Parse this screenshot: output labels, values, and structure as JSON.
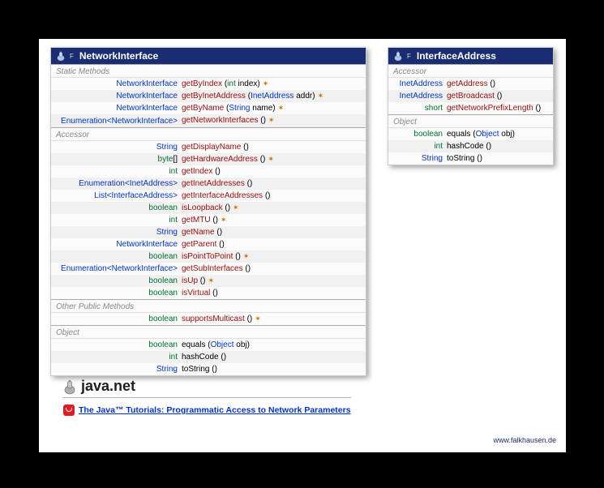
{
  "panel1": {
    "title": "NetworkInterface",
    "flag": "F",
    "sections": [
      {
        "label": "Static Methods",
        "rows": [
          {
            "ret_html": "<span class='type'>NetworkInterface</span>",
            "name": "getByIndex",
            "params_html": "(<span class='pprim'>int</span> index)",
            "throws": true,
            "red": true
          },
          {
            "ret_html": "<span class='type'>NetworkInterface</span>",
            "name": "getByInetAddress",
            "params_html": "(<span class='paramtype'>InetAddress</span> addr)",
            "throws": true,
            "red": true
          },
          {
            "ret_html": "<span class='type'>NetworkInterface</span>",
            "name": "getByName",
            "params_html": "(<span class='paramtype'>String</span> name)",
            "throws": true,
            "red": true
          },
          {
            "ret_html": "<span class='type'>Enumeration&lt;NetworkInterface&gt;</span>",
            "name": "getNetworkInterfaces",
            "params_html": "()",
            "throws": true,
            "red": true
          }
        ]
      },
      {
        "label": "Accessor",
        "rows": [
          {
            "ret_html": "<span class='type'>String</span>",
            "name": "getDisplayName",
            "params_html": "()",
            "throws": false,
            "red": true
          },
          {
            "ret_html": "<span class='prim'>byte</span>[]",
            "name": "getHardwareAddress",
            "params_html": "()",
            "throws": true,
            "red": true
          },
          {
            "ret_html": "<span class='prim'>int</span>",
            "name": "getIndex",
            "params_html": "()",
            "throws": false,
            "red": true
          },
          {
            "ret_html": "<span class='type'>Enumeration&lt;InetAddress&gt;</span>",
            "name": "getInetAddresses",
            "params_html": "()",
            "throws": false,
            "red": true
          },
          {
            "ret_html": "<span class='type'>List&lt;InterfaceAddress&gt;</span>",
            "name": "getInterfaceAddresses",
            "params_html": "()",
            "throws": false,
            "red": true
          },
          {
            "ret_html": "<span class='prim'>boolean</span>",
            "name": "isLoopback",
            "params_html": "()",
            "throws": true,
            "red": true
          },
          {
            "ret_html": "<span class='prim'>int</span>",
            "name": "getMTU",
            "params_html": "()",
            "throws": true,
            "red": true
          },
          {
            "ret_html": "<span class='type'>String</span>",
            "name": "getName",
            "params_html": "()",
            "throws": false,
            "red": true
          },
          {
            "ret_html": "<span class='type'>NetworkInterface</span>",
            "name": "getParent",
            "params_html": "()",
            "throws": false,
            "red": true
          },
          {
            "ret_html": "<span class='prim'>boolean</span>",
            "name": "isPointToPoint",
            "params_html": "()",
            "throws": true,
            "red": true
          },
          {
            "ret_html": "<span class='type'>Enumeration&lt;NetworkInterface&gt;</span>",
            "name": "getSubInterfaces",
            "params_html": "()",
            "throws": false,
            "red": true
          },
          {
            "ret_html": "<span class='prim'>boolean</span>",
            "name": "isUp",
            "params_html": "()",
            "throws": true,
            "red": true
          },
          {
            "ret_html": "<span class='prim'>boolean</span>",
            "name": "isVirtual",
            "params_html": "()",
            "throws": false,
            "red": true
          }
        ]
      },
      {
        "label": "Other Public Methods",
        "rows": [
          {
            "ret_html": "<span class='prim'>boolean</span>",
            "name": "supportsMulticast",
            "params_html": "()",
            "throws": true,
            "red": true
          }
        ]
      },
      {
        "label": "Object",
        "rows": [
          {
            "ret_html": "<span class='prim'>boolean</span>",
            "name": "equals",
            "params_html": "(<span class='paramtype'>Object</span> obj)",
            "throws": false,
            "red": false
          },
          {
            "ret_html": "<span class='prim'>int</span>",
            "name": "hashCode",
            "params_html": "()",
            "throws": false,
            "red": false
          },
          {
            "ret_html": "<span class='type'>String</span>",
            "name": "toString",
            "params_html": "()",
            "throws": false,
            "red": false
          }
        ]
      }
    ]
  },
  "panel2": {
    "title": "InterfaceAddress",
    "flag": "F",
    "sections": [
      {
        "label": "Accessor",
        "rows": [
          {
            "ret_html": "<span class='type'>InetAddress</span>",
            "name": "getAddress",
            "params_html": "()",
            "throws": false,
            "red": true
          },
          {
            "ret_html": "<span class='type'>InetAddress</span>",
            "name": "getBroadcast",
            "params_html": "()",
            "throws": false,
            "red": true
          },
          {
            "ret_html": "<span class='prim'>short</span>",
            "name": "getNetworkPrefixLength",
            "params_html": "()",
            "throws": false,
            "red": true
          }
        ]
      },
      {
        "label": "Object",
        "rows": [
          {
            "ret_html": "<span class='prim'>boolean</span>",
            "name": "equals",
            "params_html": "(<span class='paramtype'>Object</span> obj)",
            "throws": false,
            "red": false
          },
          {
            "ret_html": "<span class='prim'>int</span>",
            "name": "hashCode",
            "params_html": "()",
            "throws": false,
            "red": false
          },
          {
            "ret_html": "<span class='type'>String</span>",
            "name": "toString",
            "params_html": "()",
            "throws": false,
            "red": false
          }
        ]
      }
    ]
  },
  "package_name": "java.net",
  "tutorial_text": "The Java™ Tutorials: Programmatic Access to Network Parameters",
  "credit": "www.falkhausen.de"
}
